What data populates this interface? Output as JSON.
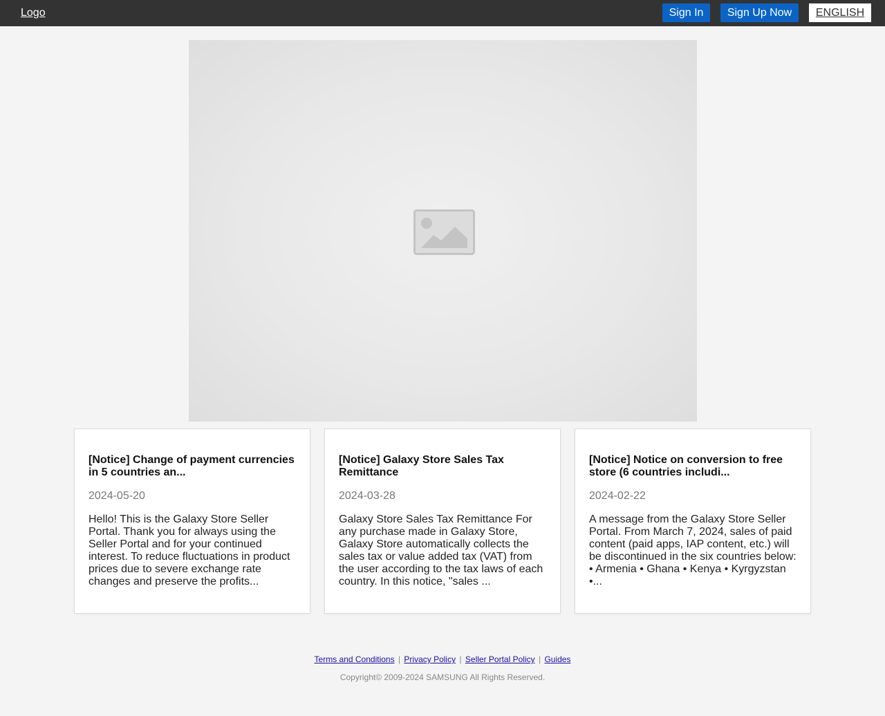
{
  "header": {
    "logo": "Logo",
    "sign_in": "Sign In",
    "sign_up": "Sign Up Now",
    "language": "ENGLISH"
  },
  "banner": {
    "icon": "image-placeholder-icon"
  },
  "notices": [
    {
      "title": "[Notice] Change of payment currencies in 5 countries an...",
      "date": "2024-05-20",
      "body": "Hello! This is the Galaxy Store Seller Portal. Thank you for always using the Seller Portal and for your continued interest. To reduce fluctuations in product prices due to severe exchange rate changes and preserve the profits..."
    },
    {
      "title": "[Notice] Galaxy Store Sales Tax Remittance",
      "date": "2024-03-28",
      "body": "Galaxy Store Sales Tax Remittance For any purchase made in Galaxy Store, Galaxy Store automatically collects the sales tax or value added tax (VAT) from the user according to the tax laws of each country. In this notice, \"sales ..."
    },
    {
      "title": "[Notice] Notice on conversion to free store (6 countries includi...",
      "date": "2024-02-22",
      "body": "A message from the Galaxy Store Seller Portal. From March 7, 2024, sales of paid content (paid apps, IAP content, etc.) will be discontinued in the six countries below: • Armenia • Ghana • Kenya • Kyrgyzstan •..."
    }
  ],
  "footer": {
    "links": [
      "Terms and Conditions",
      "Privacy Policy",
      "Seller Portal Policy",
      "Guides"
    ],
    "separator": "|",
    "copyright": "Copyright© 2009-2024 SAMSUNG All Rights Reserved."
  },
  "colors": {
    "header_bg": "#333333",
    "button_blue": "#0a64c8",
    "page_bg": "#f4f4f4",
    "link": "#1a0dab"
  }
}
